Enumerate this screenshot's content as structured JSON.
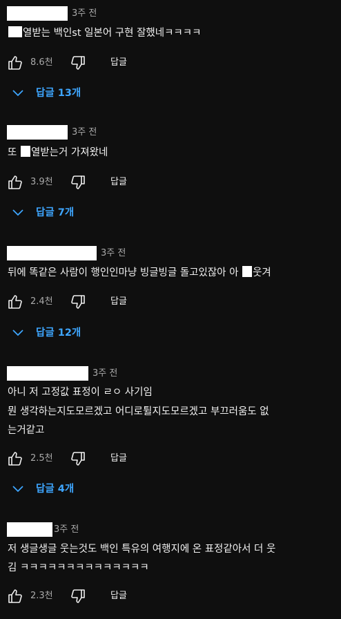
{
  "comments": [
    {
      "time": "3주 전",
      "text_after_censor": "열받는 백인st 일본어 구현 잘했네ㅋㅋㅋㅋ",
      "likes": "8.6천",
      "reply_label": "답글",
      "replies": "답글 13개"
    },
    {
      "time": "3주 전",
      "text_before_censor": "또 ",
      "text_after_censor": "열받는거 가져왔네",
      "likes": "3.9천",
      "reply_label": "답글",
      "replies": "답글 7개"
    },
    {
      "time": "3주 전",
      "text_before_censor": "뒤에 똑같은 사람이 행인인마냥 빙글빙글 돌고있잖아 아 ",
      "text_after_censor": "웃겨",
      "likes": "2.4천",
      "reply_label": "답글",
      "replies": "답글 12개"
    },
    {
      "time": "3주 전",
      "line1": "아니 저 고정값 표정이 ㄹㅇ 사기임",
      "line2": "뭔 생각하는지도모르겠고 어디로튈지도모르겠고 부끄러움도 없",
      "line3": "는거같고",
      "likes": "2.5천",
      "reply_label": "답글",
      "replies": "답글 4개"
    },
    {
      "time": "3주 전",
      "line1": "저 생글생글 웃는것도 백인 특유의 여행지에 온 표정같아서 더 웃",
      "line2": "김 ㅋㅋㅋㅋㅋㅋㅋㅋㅋㅋㅋㅋㅋㅋ",
      "likes": "2.3천",
      "reply_label": "답글"
    }
  ],
  "colors": {
    "background": "#0f0f0f",
    "text": "#f1f1f1",
    "secondary": "#aaaaaa",
    "link": "#3ea6ff"
  },
  "icons": {
    "like": "thumbs-up-icon",
    "dislike": "thumbs-down-icon",
    "expand": "chevron-down-icon"
  }
}
